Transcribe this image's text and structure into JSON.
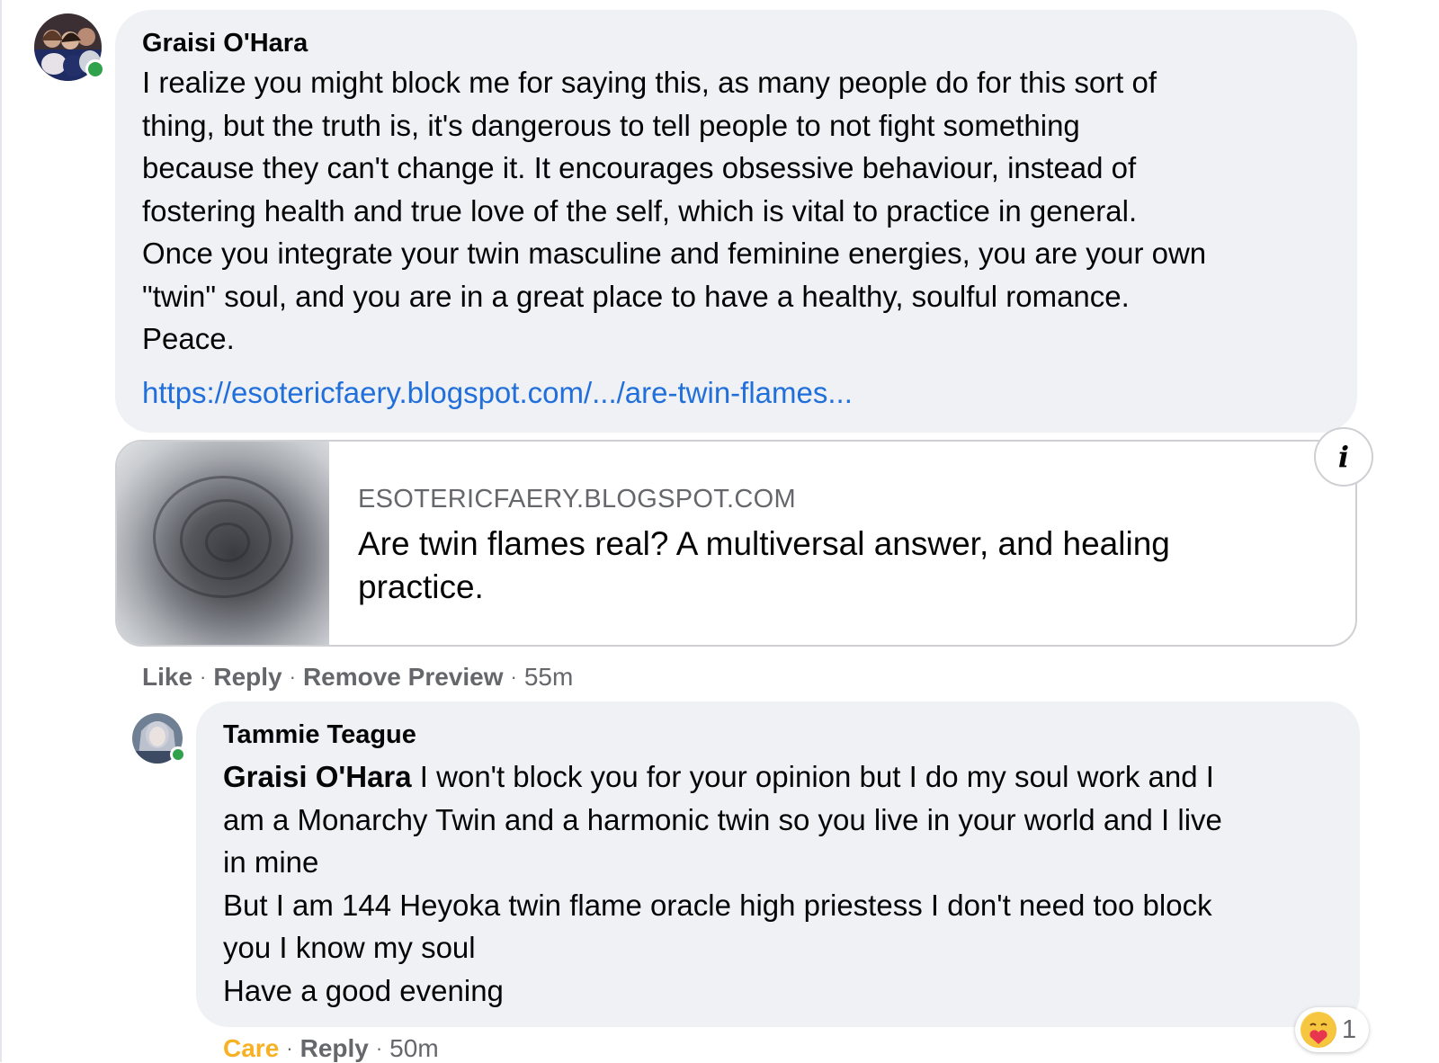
{
  "comment": {
    "author": "Graisi O'Hara",
    "body_lines": [
      "I realize you might block me for saying this, as many people do for this sort of",
      "thing, but the truth is, it's dangerous to tell people to not fight something",
      "because they can't change it. It encourages obsessive behaviour, instead of",
      "fostering health and true love of the self, which is vital to practice in general.",
      "Once you integrate your twin masculine and feminine energies, you are your own",
      "\"twin\" soul, and you are in a great place to have a healthy, soulful romance.",
      "Peace."
    ],
    "link_text": "https://esotericfaery.blogspot.com/.../are-twin-flames...",
    "preview": {
      "domain": "ESOTERICFAERY.BLOGSPOT.COM",
      "title_lines": [
        "Are twin flames real? A multiversal answer, and healing",
        "practice."
      ],
      "info_icon": "i"
    },
    "actions": {
      "like": "Like",
      "reply": "Reply",
      "remove_preview": "Remove Preview",
      "time": "55m"
    }
  },
  "reply": {
    "author": "Tammie Teague",
    "mention": "Graisi O'Hara",
    "body_lines": [
      "I won't block you for your opinion but I do my soul work and I",
      "am a Monarchy Twin and a harmonic twin so you live in your world and I live",
      "in mine",
      "But I am 144 Heyoka twin flame oracle high priestess I don't need too block",
      "you I know my soul",
      "Have a good evening"
    ],
    "actions": {
      "care": "Care",
      "reply": "Reply",
      "time": "50m"
    },
    "reaction": {
      "icon": "care-emoji-icon",
      "count": "1"
    }
  },
  "colors": {
    "bubble": "#eff1f5",
    "link": "#216fdb",
    "meta_gray": "#65676b",
    "online": "#31a24c",
    "care": "#f7b125"
  },
  "separator": "·"
}
